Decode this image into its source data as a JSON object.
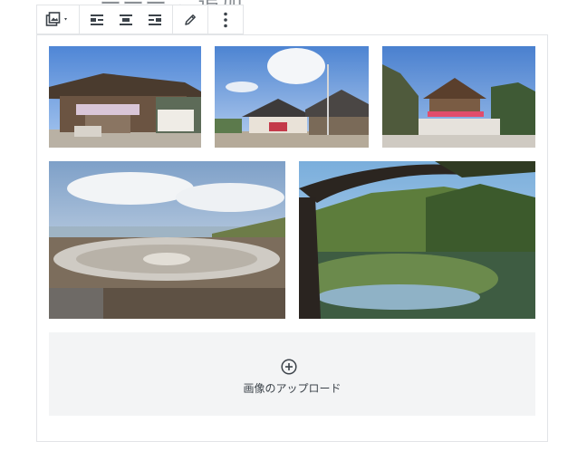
{
  "heading": {
    "partial_text": "ーーー こ追加"
  },
  "toolbar": {
    "items": [
      {
        "icon": "gallery-image-icon"
      },
      {
        "icon": "align-left-icon"
      },
      {
        "icon": "align-center-icon"
      },
      {
        "icon": "align-right-icon"
      },
      {
        "icon": "pencil-edit-icon"
      },
      {
        "icon": "more-options-icon"
      }
    ]
  },
  "gallery": {
    "images": [
      {
        "subject": "temple-gate"
      },
      {
        "subject": "temple-with-banner-pole"
      },
      {
        "subject": "temple-on-hillside"
      },
      {
        "subject": "amphitheater-by-sea"
      },
      {
        "subject": "pine-over-pond"
      }
    ]
  },
  "upload": {
    "label": "画像のアップロード",
    "icon": "plus-circle-icon"
  },
  "colors": {
    "border": "#e2e4e7",
    "placeholder_bg": "#f3f4f5",
    "icon": "#3c434a"
  }
}
